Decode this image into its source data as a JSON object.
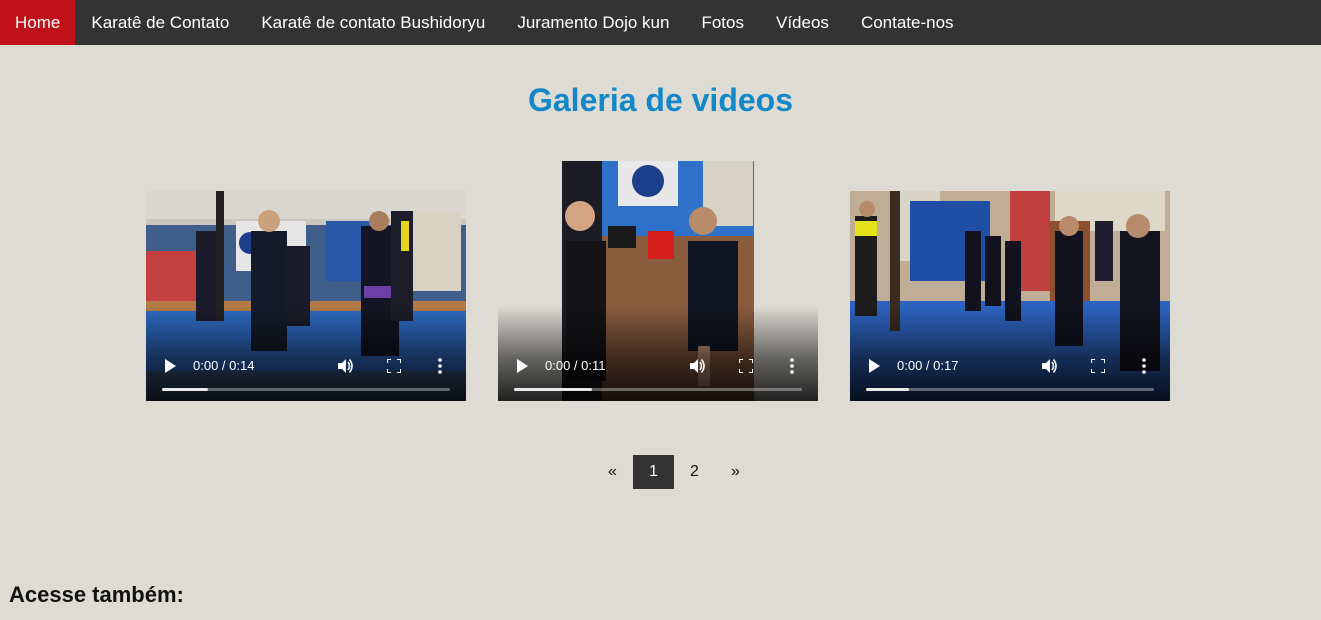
{
  "nav": {
    "items": [
      {
        "label": "Home",
        "active": true
      },
      {
        "label": "Karatê de Contato",
        "active": false
      },
      {
        "label": "Karatê de contato Bushidoryu",
        "active": false
      },
      {
        "label": "Juramento Dojo kun",
        "active": false
      },
      {
        "label": "Fotos",
        "active": false
      },
      {
        "label": "Vídeos",
        "active": false
      },
      {
        "label": "Contate-nos",
        "active": false
      }
    ]
  },
  "gallery": {
    "title": "Galeria de videos",
    "videos": [
      {
        "time": "0:00 / 0:14",
        "buffered": 0.16
      },
      {
        "time": "0:00 / 0:11",
        "buffered": 0.27
      },
      {
        "time": "0:00 / 0:17",
        "buffered": 0.15
      }
    ]
  },
  "pagination": {
    "prev": "«",
    "pages": [
      "1",
      "2"
    ],
    "current": "1",
    "next": "»"
  },
  "footer": {
    "heading": "Acesse também:"
  },
  "colors": {
    "nav_bg": "#333333",
    "nav_active": "#c0111a",
    "title": "#1388c8",
    "page_bg": "#dedbd5"
  }
}
